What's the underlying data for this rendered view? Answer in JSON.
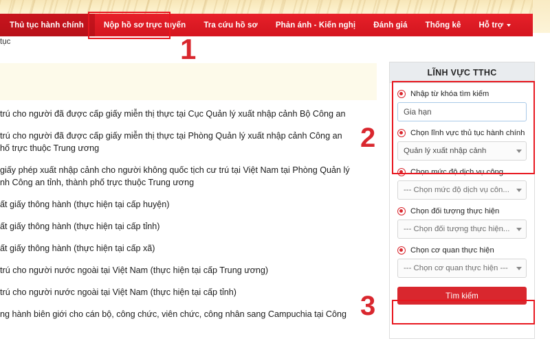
{
  "nav": {
    "items": [
      {
        "label": "Thủ tục hành chính",
        "active": true,
        "caret": false
      },
      {
        "label": "Nộp hồ sơ trực tuyến",
        "active": false,
        "caret": false
      },
      {
        "label": "Tra cứu hồ sơ",
        "active": false,
        "caret": false
      },
      {
        "label": "Phản ánh - Kiến nghị",
        "active": false,
        "caret": false
      },
      {
        "label": "Đánh giá",
        "active": false,
        "caret": false
      },
      {
        "label": "Thống kê",
        "active": false,
        "caret": false
      },
      {
        "label": "Hỗ trợ",
        "active": false,
        "caret": true
      }
    ]
  },
  "breadcrumb": {
    "text": "tục"
  },
  "annotations": {
    "one": "1",
    "two": "2",
    "three": "3",
    "color": "#d9272e"
  },
  "procedures": [
    "trú cho người đã được cấp giấy miễn thị thực tại Cục Quản lý xuất nhập cảnh Bộ Công an",
    "trú cho người đã được cấp giấy miễn thị thực tại Phòng Quản lý xuất nhập cảnh Công an\nhố trực thuộc Trung ương",
    "giấy phép xuất nhập cảnh cho người không quốc tịch cư trú tại Việt Nam tại Phòng Quản lý\nnh Công an tỉnh, thành phố trực thuộc Trung ương",
    "ất giấy thông hành (thực hiện tại cấp huyện)",
    "ất giấy thông hành (thực hiện tại cấp tỉnh)",
    "ất giấy thông hành (thực hiện tại cấp xã)",
    "trú cho người nước ngoài tại Việt Nam (thực hiện tại cấp Trung ương)",
    "trú cho người nước ngoài tại Việt Nam (thực hiện tại cấp tỉnh)",
    "ng hành biên giới cho cán bộ, công chức, viên chức, công nhân sang Campuchia tại Công"
  ],
  "panel": {
    "title": "LĨNH VỰC TTHC",
    "fields": [
      {
        "radio_label": "Nhập từ khóa tìm kiếm",
        "control": "input",
        "value": "Gia hạn",
        "placeholder": "Gia hạn"
      },
      {
        "radio_label": "Chọn lĩnh vực thủ tục hành chính",
        "control": "select",
        "value": "Quản lý xuất nhập cảnh",
        "is_placeholder": false
      },
      {
        "radio_label": "Chọn mức độ dịch vụ công",
        "control": "select",
        "value": "--- Chọn mức độ dịch vụ côn...",
        "is_placeholder": true
      },
      {
        "radio_label": "Chọn đối tượng thực hiện",
        "control": "select",
        "value": "--- Chọn đối tượng thực hiện...",
        "is_placeholder": true
      },
      {
        "radio_label": "Chọn cơ quan thực hiện",
        "control": "select",
        "value": "--- Chọn cơ quan thực hiện ---",
        "is_placeholder": true
      }
    ],
    "search_button": "Tìm kiếm"
  }
}
